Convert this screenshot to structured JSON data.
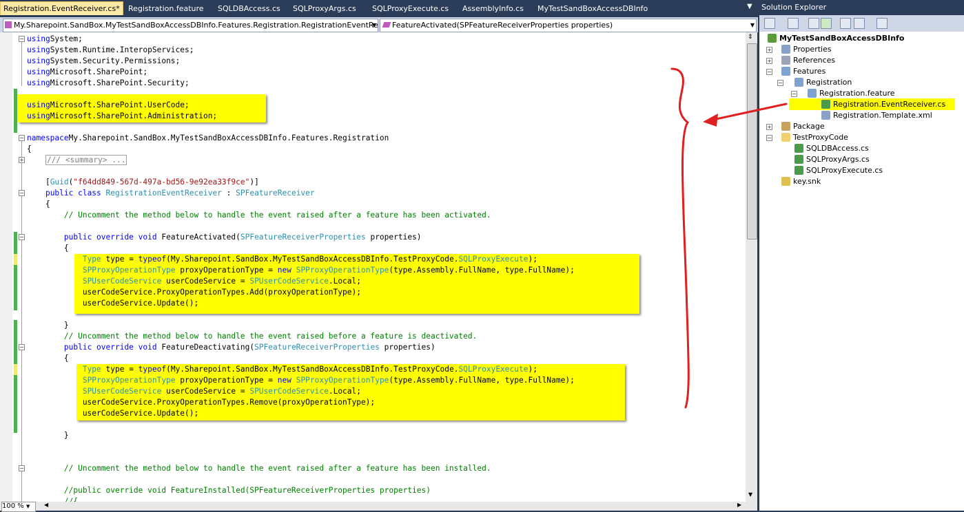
{
  "tabs": [
    {
      "label": "Registration.EventReceiver.cs*",
      "active": true
    },
    {
      "label": "Registration.feature"
    },
    {
      "label": "SQLDBAccess.cs"
    },
    {
      "label": "SQLProxyArgs.cs"
    },
    {
      "label": "SQLProxyExecute.cs"
    },
    {
      "label": "AssemblyInfo.cs"
    },
    {
      "label": "MyTestSandBoxAccessDBInfo"
    }
  ],
  "nav": {
    "class_combo": "My.Sharepoint.SandBox.MyTestSandBoxAccessDBInfo.Features.Registration.RegistrationEventReceiver",
    "member_combo": "FeatureActivated(SPFeatureReceiverProperties properties)"
  },
  "code": {
    "l1": [
      [
        "kw",
        "using"
      ],
      [
        "",
        "System;"
      ]
    ],
    "l2": [
      [
        "kw",
        "using"
      ],
      [
        "",
        "System.Runtime.InteropServices;"
      ]
    ],
    "l3": [
      [
        "kw",
        "using"
      ],
      [
        "",
        "System.Security.Permissions;"
      ]
    ],
    "l4": [
      [
        "kw",
        "using"
      ],
      [
        "",
        "Microsoft.SharePoint;"
      ]
    ],
    "l5": [
      [
        "kw",
        "using"
      ],
      [
        "",
        "Microsoft.SharePoint.Security;"
      ]
    ],
    "l7": [
      [
        "kw",
        "using"
      ],
      [
        "",
        "Microsoft.SharePoint.UserCode;"
      ]
    ],
    "l8": [
      [
        "kw",
        "using"
      ],
      [
        "",
        "Microsoft.SharePoint.Administration;"
      ]
    ],
    "l10": [
      [
        "kw",
        "namespace"
      ],
      [
        "",
        "My.Sharepoint.SandBox.MyTestSandBoxAccessDBInfo.Features.Registration"
      ]
    ],
    "l11": [
      [
        "",
        "{"
      ]
    ],
    "l12": [
      [
        "",
        "    "
      ],
      [
        "gr",
        "/// <summary> ..."
      ]
    ],
    "l14": [
      [
        "",
        "    ["
      ],
      [
        "ty",
        "Guid"
      ],
      [
        "",
        "("
      ],
      [
        "st",
        "\"f64dd849-567d-497a-bd56-9e92ea33f9ce\""
      ],
      [
        "",
        ")]"
      ]
    ],
    "l15": [
      [
        "",
        "    "
      ],
      [
        "kw",
        "public class"
      ],
      [
        "",
        " "
      ],
      [
        "ty",
        "RegistrationEventReceiver"
      ],
      [
        "",
        " : "
      ],
      [
        "ty",
        "SPFeatureReceiver"
      ]
    ],
    "l16": [
      [
        "",
        "    {"
      ]
    ],
    "l17": [
      [
        "",
        "        "
      ],
      [
        "cm",
        "// Uncomment the method below to handle the event raised after a feature has been activated."
      ]
    ],
    "l19": [
      [
        "",
        "        "
      ],
      [
        "kw",
        "public override void"
      ],
      [
        "",
        " FeatureActivated("
      ],
      [
        "ty",
        "SPFeatureReceiverProperties"
      ],
      [
        "",
        " properties)"
      ]
    ],
    "l20": [
      [
        "",
        "        {"
      ]
    ],
    "l21": [
      [
        "",
        "            "
      ],
      [
        "ty",
        "Type"
      ],
      [
        "",
        " type = "
      ],
      [
        "kw",
        "typeof"
      ],
      [
        "",
        "(My.Sharepoint.SandBox.MyTestSandBoxAccessDBInfo.TestProxyCode."
      ],
      [
        "ty",
        "SQLProxyExecute"
      ],
      [
        "",
        ");"
      ]
    ],
    "l22": [
      [
        "",
        "            "
      ],
      [
        "ty",
        "SPProxyOperationType"
      ],
      [
        "",
        " proxyOperationType = "
      ],
      [
        "kw",
        "new"
      ],
      [
        "",
        " "
      ],
      [
        "ty",
        "SPProxyOperationType"
      ],
      [
        "",
        "(type.Assembly.FullName, type.FullName);"
      ]
    ],
    "l23": [
      [
        "",
        "            "
      ],
      [
        "ty",
        "SPUserCodeService"
      ],
      [
        "",
        " userCodeService = "
      ],
      [
        "ty",
        "SPUserCodeService"
      ],
      [
        "",
        ".Local;"
      ]
    ],
    "l24": [
      [
        "",
        "            userCodeService.ProxyOperationTypes.Add(proxyOperationType);"
      ]
    ],
    "l25": [
      [
        "",
        "            userCodeService.Update();"
      ]
    ],
    "l27": [
      [
        "",
        "        }"
      ]
    ],
    "l28": [
      [
        "",
        "        "
      ],
      [
        "cm",
        "// Uncomment the method below to handle the event raised before a feature is deactivated."
      ]
    ],
    "l29": [
      [
        "",
        "        "
      ],
      [
        "kw",
        "public override void"
      ],
      [
        "",
        " FeatureDeactivating("
      ],
      [
        "ty",
        "SPFeatureReceiverProperties"
      ],
      [
        "",
        " properties)"
      ]
    ],
    "l30": [
      [
        "",
        "        {"
      ]
    ],
    "l31": [
      [
        "",
        "            "
      ],
      [
        "ty",
        "Type"
      ],
      [
        "",
        " type = "
      ],
      [
        "kw",
        "typeof"
      ],
      [
        "",
        "(My.Sharepoint.SandBox.MyTestSandBoxAccessDBInfo.TestProxyCode."
      ],
      [
        "ty",
        "SQLProxyExecute"
      ],
      [
        "",
        ");"
      ]
    ],
    "l32": [
      [
        "",
        "            "
      ],
      [
        "ty",
        "SPProxyOperationType"
      ],
      [
        "",
        " proxyOperationType = "
      ],
      [
        "kw",
        "new"
      ],
      [
        "",
        " "
      ],
      [
        "ty",
        "SPProxyOperationType"
      ],
      [
        "",
        "(type.Assembly.FullName, type.FullName);"
      ]
    ],
    "l33": [
      [
        "",
        "            "
      ],
      [
        "ty",
        "SPUserCodeService"
      ],
      [
        "",
        " userCodeService = "
      ],
      [
        "ty",
        "SPUserCodeService"
      ],
      [
        "",
        ".Local;"
      ]
    ],
    "l34": [
      [
        "",
        "            userCodeService.ProxyOperationTypes.Remove(proxyOperationType);"
      ]
    ],
    "l35": [
      [
        "",
        "            userCodeService.Update();"
      ]
    ],
    "l37": [
      [
        "",
        "        }"
      ]
    ],
    "l40": [
      [
        "",
        "        "
      ],
      [
        "cm",
        "// Uncomment the method below to handle the event raised after a feature has been installed."
      ]
    ],
    "l42": [
      [
        "",
        "        "
      ],
      [
        "cm",
        "//public override void FeatureInstalled(SPFeatureReceiverProperties properties)"
      ]
    ],
    "l43": [
      [
        "",
        "        "
      ],
      [
        "cm",
        "//{"
      ]
    ]
  },
  "zoom": "100 %",
  "solution_explorer": {
    "title": "Solution Explorer",
    "project": "MyTestSandBoxAccessDBInfo",
    "properties": "Properties",
    "references": "References",
    "features": "Features",
    "registration": "Registration",
    "registration_feature": "Registration.feature",
    "event_receiver": "Registration.EventReceiver.cs",
    "template": "Registration.Template.xml",
    "package": "Package",
    "test_proxy_code": "TestProxyCode",
    "sqldbaccess": "SQLDBAccess.cs",
    "sqlproxyargs": "SQLProxyArgs.cs",
    "sqlproxyexecute": "SQLProxyExecute.cs",
    "key": "key.snk"
  },
  "colors": {
    "highlight": "#ffff00",
    "annotation": "#e02020",
    "keyword": "#0000ff",
    "type": "#2b91af",
    "comment": "#008000",
    "string": "#a31515"
  }
}
